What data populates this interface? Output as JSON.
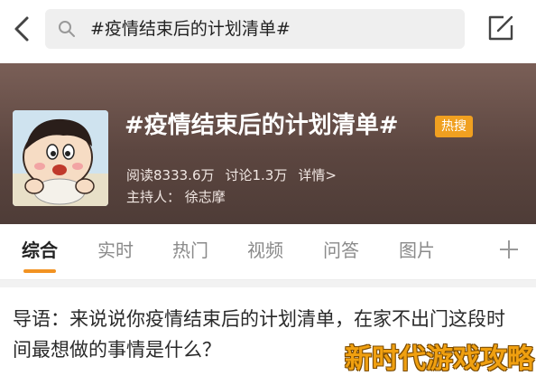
{
  "search": {
    "query": "#疫情结束后的计划清单#"
  },
  "topic": {
    "title": "#疫情结束后的计划清单#",
    "badge": "热搜",
    "reads": "阅读8333.6万",
    "discussions": "讨论1.3万",
    "details": "详情>",
    "host": "主持人： 徐志摩"
  },
  "tabs": [
    {
      "label": "综合",
      "active": true
    },
    {
      "label": "实时"
    },
    {
      "label": "热门"
    },
    {
      "label": "视频"
    },
    {
      "label": "问答"
    },
    {
      "label": "图片"
    }
  ],
  "intro": {
    "text": "导语：来说说你疫情结束后的计划清单，在家不出门这段时间最想做的事情是什么？"
  },
  "watermark": {
    "text": "新时代游戏攻略"
  },
  "colors": {
    "accent": "#f29322",
    "badge": "#f0a020",
    "banner": "#5c4640"
  },
  "icons": [
    "back-arrow-icon",
    "search-icon",
    "edit-icon",
    "plus-icon"
  ]
}
